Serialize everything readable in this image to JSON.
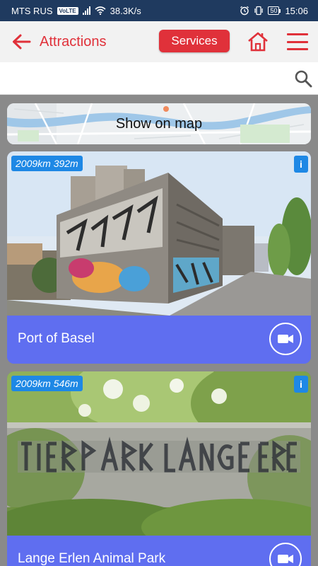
{
  "status_bar": {
    "carrier": "MTS RUS",
    "volte": "VoLTE",
    "speed": "38.3K/s",
    "battery": "50",
    "time": "15:06"
  },
  "header": {
    "title": "Attractions",
    "services_label": "Services",
    "back_icon": "arrow-left-icon",
    "home_icon": "home-icon",
    "menu_icon": "hamburger-menu-icon"
  },
  "search": {
    "value": "",
    "placeholder": "",
    "icon": "search-icon"
  },
  "map": {
    "label": "Show on map"
  },
  "attractions": [
    {
      "distance": "2009km 392m",
      "name": "Port of Basel",
      "info": "i"
    },
    {
      "distance": "2009km 546m",
      "name": "Lange Erlen Animal Park",
      "info": "i"
    }
  ],
  "colors": {
    "accent": "#e0313a",
    "card": "#5f6ef0",
    "badge": "#1e88e5",
    "status_bar": "#1f3a5f"
  }
}
